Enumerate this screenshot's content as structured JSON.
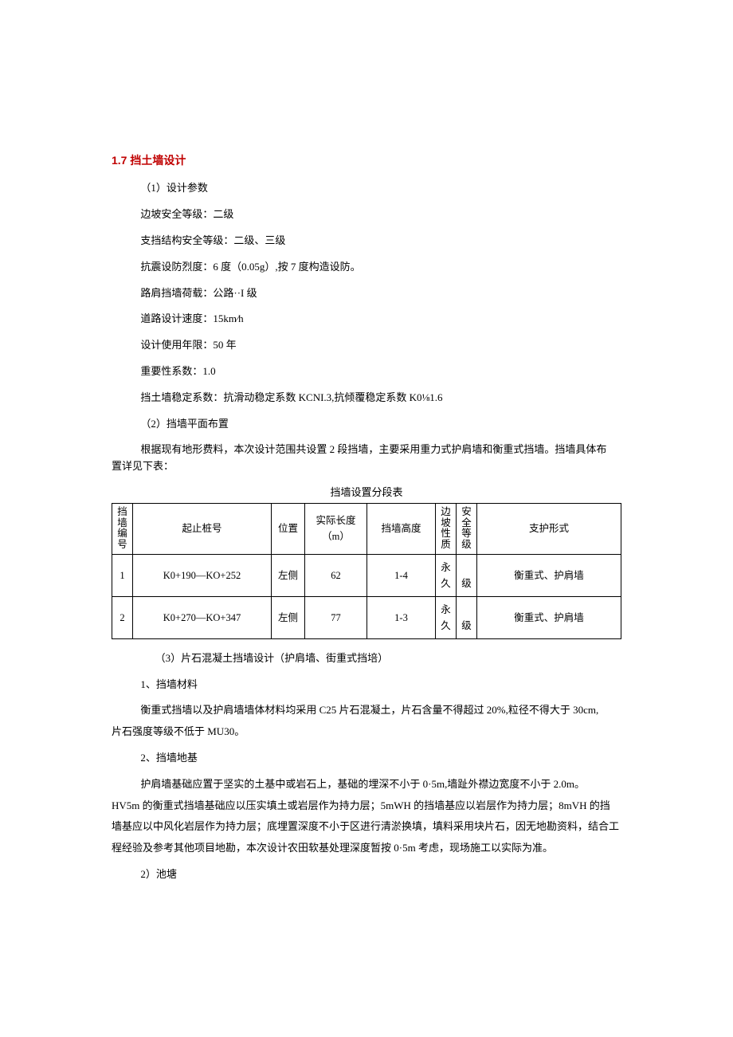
{
  "section": {
    "number": "1.7",
    "title": "挡土墙设计"
  },
  "params": {
    "heading": "（1）设计参数",
    "p1": "边坡安全等级：二级",
    "p2": "支挡结构安全等级：二级、三级",
    "p3": "抗震设防烈度：6 度（0.05g）,按 7 度构造设防。",
    "p4": "路肩挡墙荷载：公路··I 级",
    "p5": "道路设计速度：15km⁄h",
    "p6": "设计使用年限：50 年",
    "p7": "重要性系数：1.0",
    "p8": "挡土墙稳定系数：抗滑动稳定系数 KCNI.3,抗倾覆稳定系数 K0⅛1.6"
  },
  "layout": {
    "heading": "（2）挡墙平面布置",
    "intro_a": "根据现有地形费料，本次设计范围共设置 2 段挡墙，主要采用重力式护肩墙和衡重式挡墙。挡墙具体布",
    "intro_b": "置详见下表："
  },
  "table": {
    "caption": "挡墙设置分段表",
    "headers": {
      "num": "挡墙编号",
      "pile": "起止桩号",
      "pos": "位置",
      "len": "实际长度（m）",
      "height": "挡墙高度",
      "slope": "边坡性质",
      "safe": "安全等级",
      "support": "支护形式"
    },
    "rows": [
      {
        "num": "1",
        "pile": "K0+190—KO+252",
        "pos": "左侧",
        "len": "62",
        "height": "1-4",
        "slope": "永久",
        "safe": "级",
        "support": "衡重式、护肩墙"
      },
      {
        "num": "2",
        "pile": "K0+270—KO+347",
        "pos": "左侧",
        "len": "77",
        "height": "1-3",
        "slope": "永久",
        "safe": "级",
        "support": "衡重式、护肩墙"
      }
    ]
  },
  "design": {
    "heading": "（3）片石混凝土挡墙设计（护肩墙、街重式挡培）",
    "material_h": "1、挡墙材料",
    "material_a": "衡重式挡墙以及护肩墙墙体材料均采用 C25 片石混凝土，片石含量不得超过 20%,粒径不得大于 30cm,",
    "material_b": "片石强度等级不低于 MU30。",
    "foundation_h": "2、挡墙地基",
    "foundation_a": "护肩墙基础应置于坚实的土基中或岩石上，基础的埋深不小于 0·5m,墙趾外襟边宽度不小于 2.0m。",
    "foundation_b": "HV5m 的衡重式挡墙基础应以压实填土或岩层作为持力层；5mWH 的挡墙基应以岩层作为持力层；8mVH 的挡",
    "foundation_c": "墙基应以中风化岩层作为持力层；底埋置深度不小于区进行清淤换填，填料采用块片石，因无地勘资料，结合工",
    "foundation_d": "程经验及参考其他项目地勘，本次设计农田软基处理深度暂按 0·5m 考虑，现场施工以实际为准。",
    "pond": "2）池塘"
  }
}
